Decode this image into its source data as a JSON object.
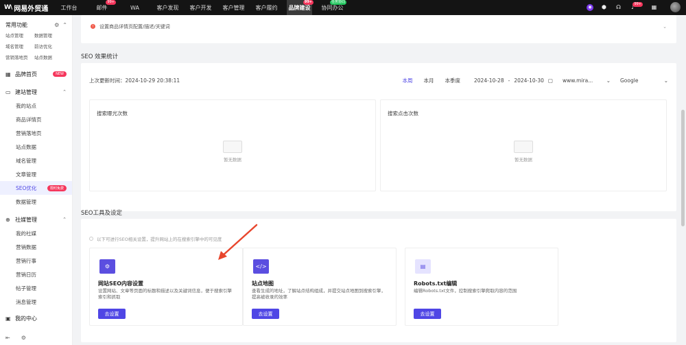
{
  "topbar": {
    "logo_mark": "W\\",
    "logo_text": "网易外贸通",
    "nav": [
      {
        "label": "工作台"
      },
      {
        "label": "邮件",
        "badge": "99+"
      },
      {
        "label": "WA"
      },
      {
        "label": "客户发现"
      },
      {
        "label": "客户开发"
      },
      {
        "label": "客户管理"
      },
      {
        "label": "客户履约"
      },
      {
        "label": "品牌建设",
        "badge": "99+",
        "active": true
      },
      {
        "label": "协同办公",
        "badge": "任务协同"
      }
    ],
    "icons": {
      "notify_badge": "99+"
    }
  },
  "sidebar": {
    "common_title": "常用功能",
    "quick": [
      "站点管理",
      "数据管理",
      "域名管理",
      "前访优化",
      "营销落地页",
      "站点数据"
    ],
    "sections": [
      {
        "label": "品牌首页",
        "icon": "grid-icon",
        "hot": "NEW"
      },
      {
        "label": "建站管理",
        "icon": "monitor-icon"
      }
    ],
    "site_items": [
      "我的站点",
      "商品详情页",
      "营销落地页",
      "站点数据",
      "域名管理",
      "文章管理",
      "SEO优化",
      "数据管理"
    ],
    "site_active_hot": "限时免费",
    "social_title": "社媒管理",
    "social_items": [
      "我的社媒",
      "营销数据",
      "营销行事",
      "营销日历",
      "帖子管理",
      "消息管理"
    ],
    "material": "我的中心"
  },
  "hint": {
    "text": "设置商品详情页配置/描述/关键词"
  },
  "stats": {
    "title": "SEO 效果统计",
    "updated": "上次更新时间：2024-10-29 20:38:11",
    "ranges": [
      "本周",
      "本月",
      "本季度"
    ],
    "active_range": "本周",
    "date_from": "2024-10-28",
    "date_sep": "-",
    "date_to": "2024-10-30",
    "site": "www.mira...",
    "engine": "Google",
    "panels": [
      {
        "title": "搜索曝光次数"
      },
      {
        "title": "搜索点击次数"
      }
    ],
    "empty": "暂无数据"
  },
  "tools": {
    "title": "SEO工具及设定",
    "hint": "以下可进行SEO相关设置，提升网站上的在搜索引擎中的可见度",
    "cards": [
      {
        "name": "网站SEO内容设置",
        "desc": "设置网站、文章等页面的标题和描述以及关键词信息，便于搜索引擎索引和抓取",
        "btn": "去设置",
        "icon": "gear-icon"
      },
      {
        "name": "站点地图",
        "desc": "查看生成的地址，了解站点结构组成，并提交站点地图到搜索引擎，提高被收录的效率",
        "btn": "去设置",
        "icon": "code-icon"
      },
      {
        "name": "Robots.txt编辑",
        "desc": "编辑Robots.txt文件，控制搜索引擎爬取内容的范围",
        "btn": "去设置",
        "icon": "txt-file-icon"
      }
    ]
  }
}
